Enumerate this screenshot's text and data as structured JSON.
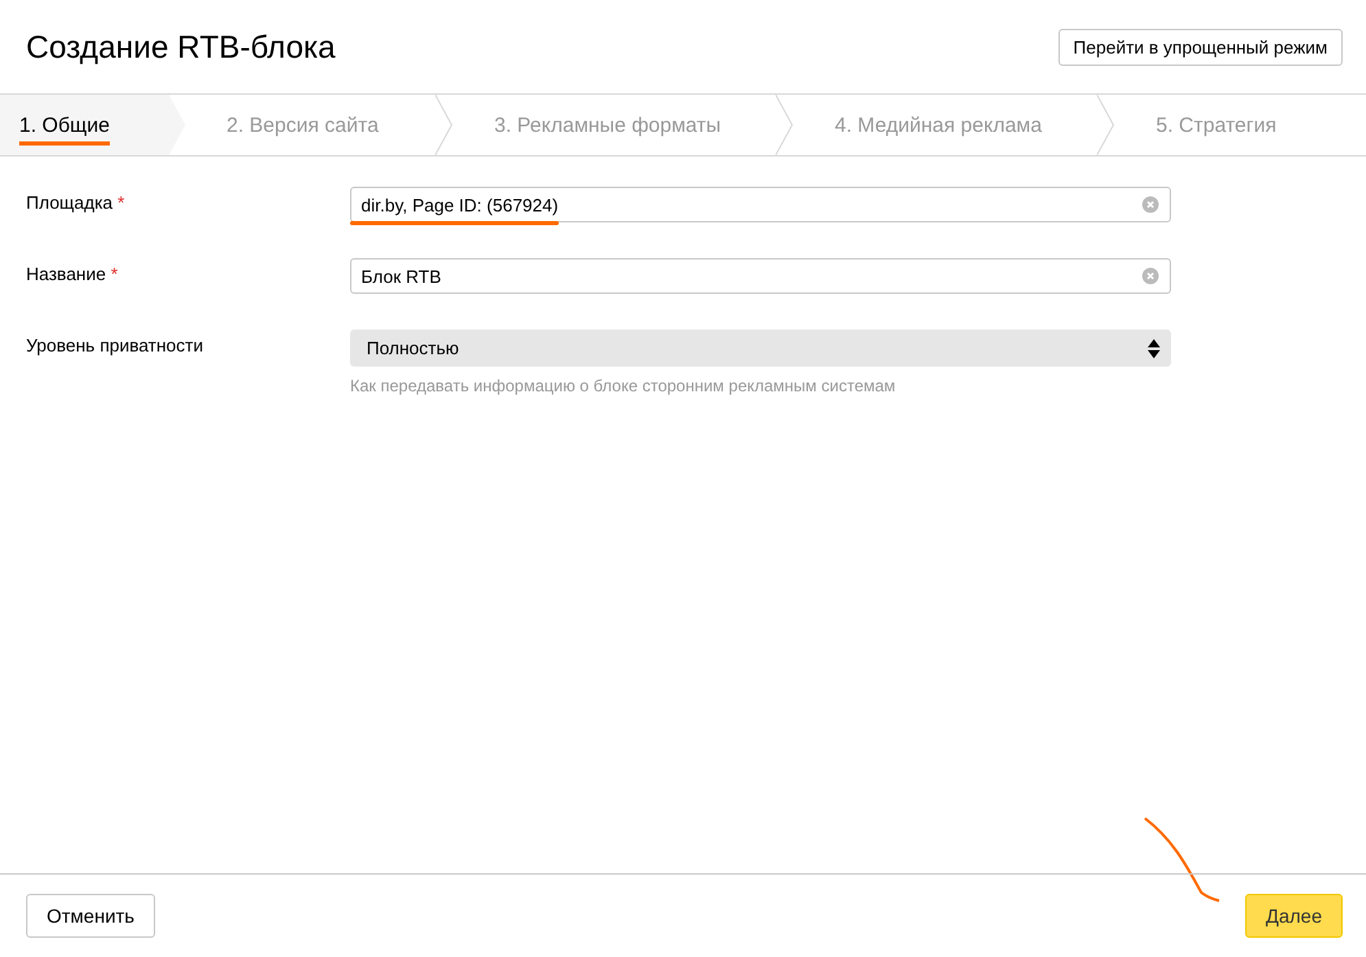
{
  "header": {
    "title": "Создание RTB-блока",
    "mode_button": "Перейти в упрощенный режим"
  },
  "steps": [
    {
      "label": "1. Общие",
      "selected": true
    },
    {
      "label": "2. Версия сайта",
      "selected": false
    },
    {
      "label": "3. Рекламные форматы",
      "selected": false
    },
    {
      "label": "4. Медийная реклама",
      "selected": false
    },
    {
      "label": "5. Стратегия",
      "selected": false
    }
  ],
  "fields": [
    {
      "kind": "text",
      "label": "Площадка",
      "required_mark": "*",
      "value": "dir.by, Page ID: (567924)",
      "annotated": true
    },
    {
      "kind": "text",
      "label": "Название",
      "required_mark": "*",
      "value": "Блок RTB",
      "annotated": false
    },
    {
      "kind": "select",
      "label": "Уровень приватности",
      "value": "Полностью",
      "hint": "Как передавать информацию о блоке сторонним рекламным системам"
    }
  ],
  "footer": {
    "cancel": "Отменить",
    "next": "Далее"
  }
}
